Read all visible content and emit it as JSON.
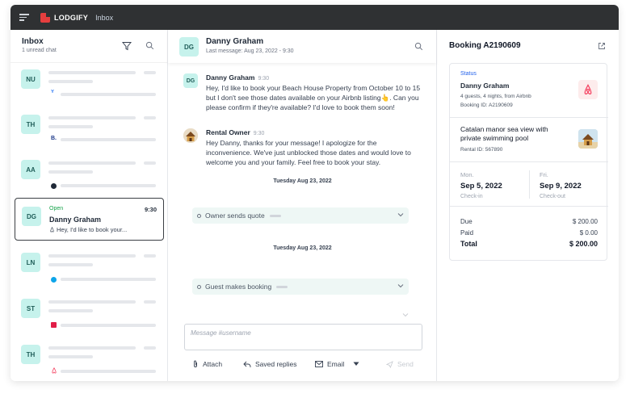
{
  "app": {
    "brand": "LODGIFY",
    "breadcrumb": "Inbox"
  },
  "inbox": {
    "title": "Inbox",
    "subtitle": "1 unread chat",
    "conversations": [
      {
        "initials": "NU",
        "source_color": "#3b82f6"
      },
      {
        "initials": "TH",
        "source_icon_text": "B.",
        "source_color": "#1e3a8a"
      },
      {
        "initials": "AA",
        "source_color": "#1f2937"
      },
      {
        "initials": "DG",
        "status": "Open",
        "name": "Danny Graham",
        "time": "9:30",
        "preview": "Hey, I'd like to book your..."
      },
      {
        "initials": "LN",
        "source_color": "#0ea5e9"
      },
      {
        "initials": "ST",
        "source_color": "#e11d48"
      },
      {
        "initials": "TH",
        "source_color": "#f43f5e"
      }
    ]
  },
  "chat": {
    "contact_initials": "DG",
    "contact_name": "Danny Graham",
    "last_message": "Last message: Aug 23, 2022 - 9:30",
    "messages": [
      {
        "initials": "DG",
        "author": "Danny Graham",
        "time": "9:30",
        "text": "Hey, I'd like to book your Beach House Property from October 10 to 15 but I don't see those dates available on your Airbnb listing👆. Can you please confirm if they're available? I'd love to book them soon!"
      },
      {
        "author": "Rental Owner",
        "time": "9:30",
        "text": "Hey Danny, thanks for your message! I apologize for the inconvenience. We've just unblocked those dates and would love to welcome you and your family. Feel free to book your stay."
      }
    ],
    "date_separators": [
      "Tuesday Aug 23, 2022",
      "Tuesday Aug 23, 2022"
    ],
    "events": [
      "Owner sends quote",
      "Guest makes booking"
    ],
    "composer_placeholder": "Message #username",
    "toolbar": {
      "attach": "Attach",
      "saved_replies": "Saved replies",
      "email": "Email",
      "send": "Send"
    }
  },
  "booking": {
    "title": "Booking A2190609",
    "status_label": "Status",
    "guest_name": "Danny Graham",
    "guest_details": "4 guests, 4 nights, from Airbnb",
    "booking_id": "Booking ID: A2190609",
    "property_name": "Catalan manor sea view with private swimming pool",
    "rental_id": "Rental ID: 567890",
    "checkin_day": "Mon.",
    "checkin_date": "Sep 5, 2022",
    "checkin_label": "Check-in",
    "checkout_day": "Fri.",
    "checkout_date": "Sep 9, 2022",
    "checkout_label": "Check-out",
    "due_label": "Due",
    "due_value": "$ 200.00",
    "paid_label": "Paid",
    "paid_value": "$ 0.00",
    "total_label": "Total",
    "total_value": "$ 200.00"
  },
  "colors": {
    "accent": "#c6f2ec",
    "brand": "#e53e3e",
    "topbar": "#2f3133",
    "event_bg": "#eef7f5"
  }
}
